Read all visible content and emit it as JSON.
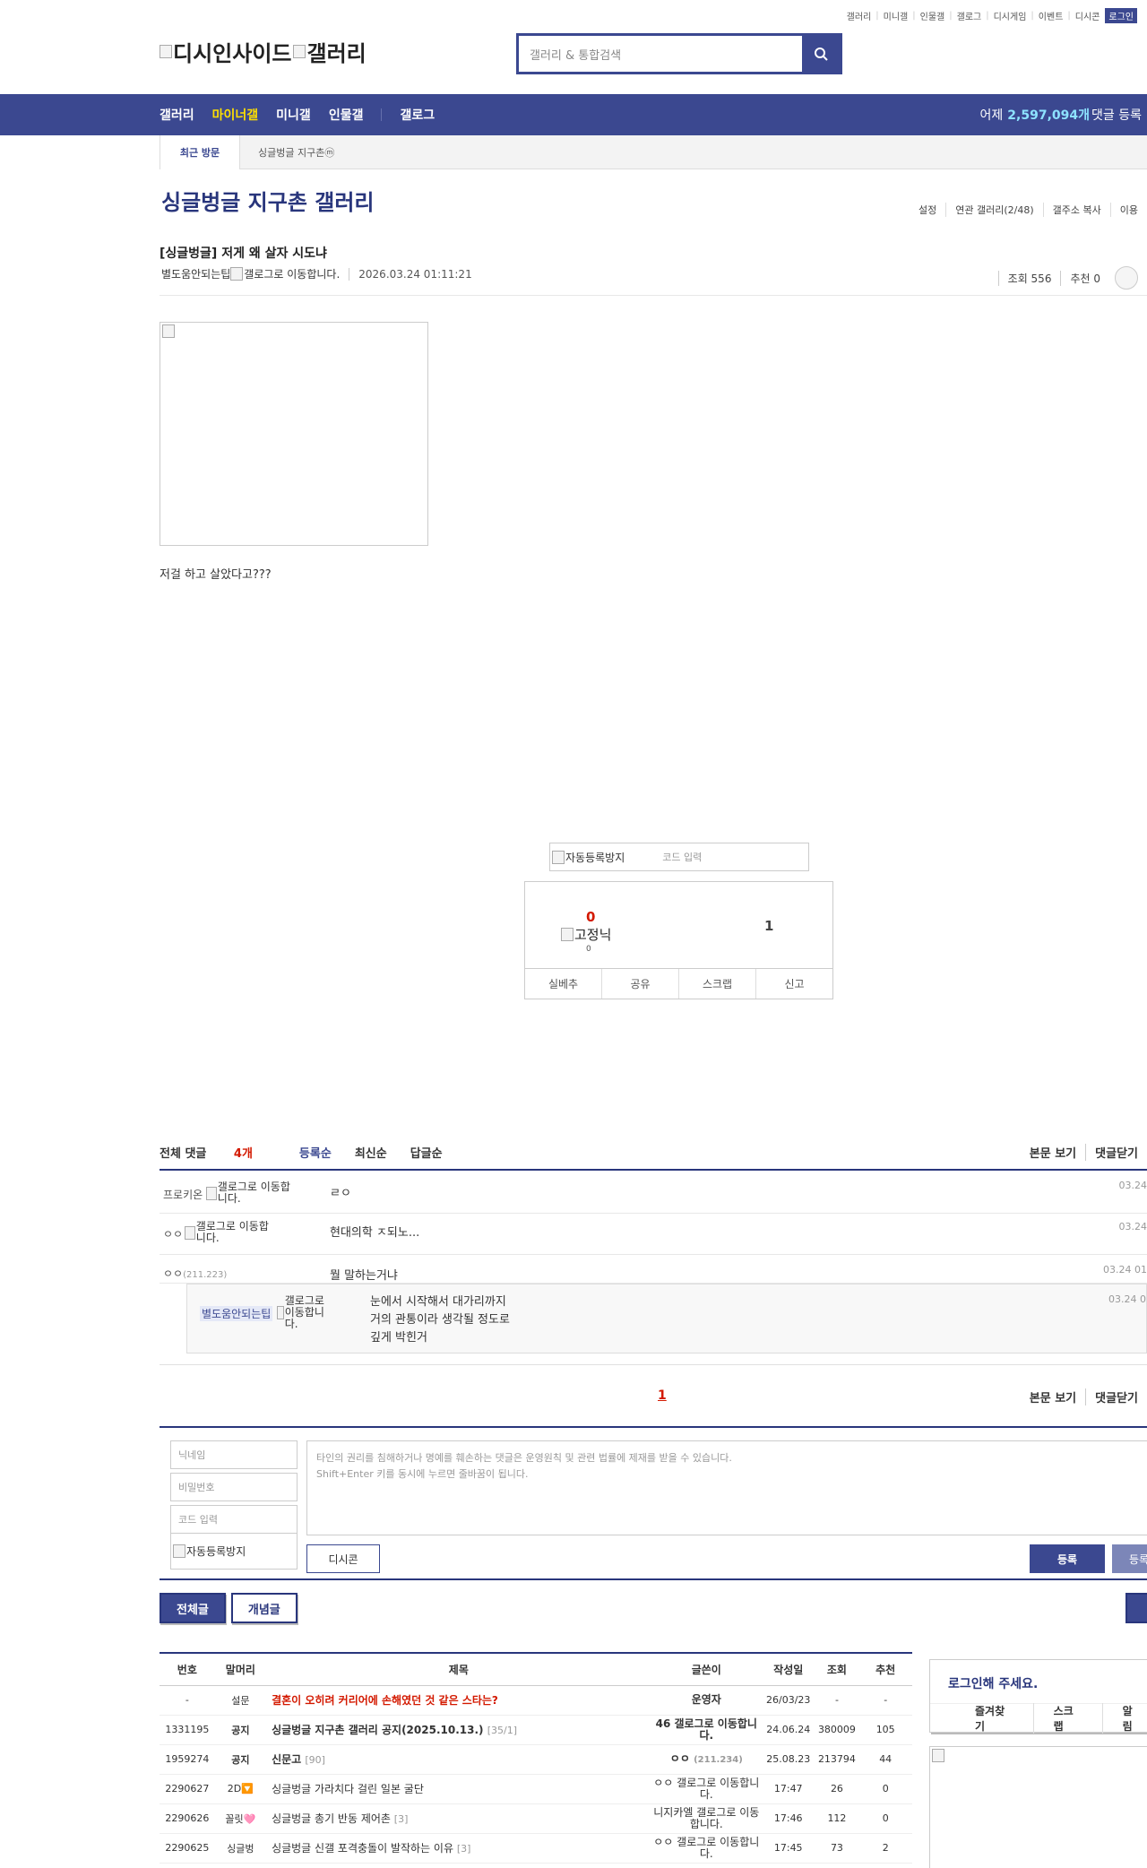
{
  "util_links": [
    "갤러리",
    "미니갤",
    "인물갤",
    "갤로그",
    "디시게임",
    "이벤트",
    "디시콘"
  ],
  "login_label": "로그인",
  "logo": {
    "left_alt": "디시인사이드",
    "right_alt": "갤러리"
  },
  "search": {
    "placeholder": "갤러리 & 통합검색"
  },
  "gnb": {
    "items": [
      "갤러리",
      "마이너갤",
      "미니갤",
      "인물갤",
      "갤로그"
    ],
    "stat_prefix": "어제",
    "stat_value": "2,597,094개",
    "stat_suffix": "댓글 등록"
  },
  "recent": {
    "title": "최근 방문",
    "item": "싱글벙글 지구촌ⓜ"
  },
  "gallery": {
    "title": "싱글벙글 지구촌 갤러리",
    "options": [
      "설정",
      "연관 갤러리(2/48)",
      "갤주소 복사",
      "이용"
    ]
  },
  "post": {
    "title": "[싱글벙글] 저게 왜 살자 시도냐",
    "author": "별도움안되는팁",
    "author_img_alt": "갤로그로 이동합니다.",
    "date": "2026.03.24 01:11:21",
    "views": "조회 556",
    "recommend": "추천 0",
    "body_text": "저걸 하고 살았다고???"
  },
  "captcha": {
    "img_alt": "자동등록방지",
    "code_placeholder": "코드 입력"
  },
  "recommend_box": {
    "up_count": "0",
    "fixed_alt": "고정닉",
    "fixed_count": "0",
    "down_count": "1",
    "buttons": [
      "실베추",
      "공유",
      "스크랩",
      "신고"
    ]
  },
  "comments": {
    "total_label": "전체 댓글",
    "total_count": "4개",
    "sort": [
      "등록순",
      "최신순",
      "답글순"
    ],
    "actions": [
      "본문 보기",
      "댓글닫기"
    ],
    "items": [
      {
        "nick": "프로키온",
        "img_alt": "갤로그로 이동합니다.",
        "memo": "ㄹㅇ",
        "date": "03.24"
      },
      {
        "nick": "ㅇㅇ",
        "img_alt": "갤로그로 이동합니다.",
        "memo": "현대의학 ㅈ되노...",
        "date": "03.24"
      },
      {
        "nick": "ㅇㅇ",
        "ip": "(211.223)",
        "memo": "뭘 말하는거냐",
        "date": "03.24 01"
      }
    ],
    "reply": {
      "nick": "별도움안되는팁",
      "img_alt": "갤로그로 이동합니다.",
      "memo_lines": [
        "눈에서 시작해서 대가리까지",
        "거의 관통이라 생각될 정도로",
        "깊게 박힌거"
      ],
      "date": "03.24 0"
    },
    "page": "1"
  },
  "write_form": {
    "nickname_ph": "닉네임",
    "password_ph": "비밀번호",
    "code_ph": "코드 입력",
    "captcha_alt": "자동등록방지",
    "textarea_line1": "타인의 권리를 침해하거나 명예를 훼손하는 댓글은 운영원칙 및 관련 법률에 제재를 받을 수 있습니다.",
    "textarea_line2": "Shift+Enter 키를 동시에 누르면 줄바꿈이 됩니다.",
    "dccon_label": "디시콘",
    "register_label": "등록",
    "register2_label": "등록"
  },
  "list_tabs": [
    "전체글",
    "개념글"
  ],
  "list": {
    "headers": [
      "번호",
      "말머리",
      "제목",
      "글쓴이",
      "작성일",
      "조회",
      "추천"
    ],
    "rows": [
      {
        "num": "-",
        "head": "설문",
        "title": "결혼이 오히려 커리어에 손해였던 것 같은 스타는?",
        "cc": "",
        "writer": "운영자",
        "date": "26/03/23",
        "views": "-",
        "rec": "-",
        "type": "hot"
      },
      {
        "num": "1331195",
        "head": "공지",
        "title": "싱글벙글 지구촌 갤러리 공지(2025.10.13.)",
        "cc": "[35/1]",
        "writer": "46 갤로그로 이동합니다.",
        "date": "24.06.24",
        "views": "380009",
        "rec": "105",
        "type": "notice"
      },
      {
        "num": "1959274",
        "head": "공지",
        "title": "신문고",
        "cc": "[90]",
        "writer": "ㅇㅇ",
        "ip": "(211.234)",
        "date": "25.08.23",
        "views": "213794",
        "rec": "44",
        "type": "notice"
      },
      {
        "num": "2290627",
        "head": "2D🔽",
        "title": "싱글벙글 가라치다 걸린 일본 굴단",
        "cc": "",
        "writer": "ㅇㅇ 갤로그로 이동합니다.",
        "date": "17:47",
        "views": "26",
        "rec": "0",
        "type": ""
      },
      {
        "num": "2290626",
        "head": "꼴릿🩷",
        "title": "싱글벙글 총기 반동 제어촌",
        "cc": "[3]",
        "writer": "니지카엘 갤로그로 이동합니다.",
        "date": "17:46",
        "views": "112",
        "rec": "0",
        "type": ""
      },
      {
        "num": "2290625",
        "head": "싱글벙",
        "title": "싱글벙글 신갤 포격충돌이 발작하는 이유",
        "cc": "[3]",
        "writer": "ㅇㅇ 갤로그로 이동합니다.",
        "date": "17:45",
        "views": "73",
        "rec": "2",
        "type": ""
      }
    ]
  },
  "sidebar": {
    "login_prompt": "로그인해 주세요.",
    "links": [
      "즐겨찾기",
      "스크랩",
      "알림"
    ]
  },
  "colors": {
    "brand": "#3b4890",
    "brand_dark": "#29367c",
    "highlight": "#fedf00",
    "accent_red": "#d31900"
  }
}
